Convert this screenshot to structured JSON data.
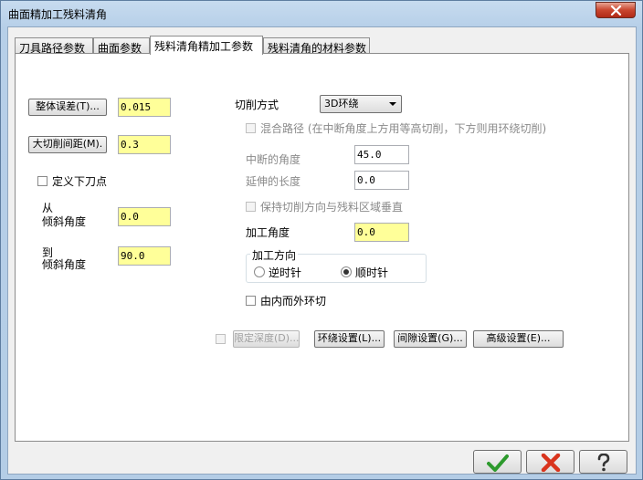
{
  "window": {
    "title": "曲面精加工残料清角"
  },
  "tabs": [
    {
      "label": "刀具路径参数"
    },
    {
      "label": "曲面参数"
    },
    {
      "label": "残料清角精加工参数"
    },
    {
      "label": "残料清角的材料参数"
    }
  ],
  "left": {
    "tolerance_button": "整体误差(T)...",
    "tolerance_value": "0.015",
    "stepover_button": "大切削间距(M).",
    "stepover_value": "0.3",
    "entry_point_label": "定义下刀点",
    "from_label_1": "从",
    "from_label_2": "倾斜角度",
    "from_value": "0.0",
    "to_label_1": "到",
    "to_label_2": "倾斜角度",
    "to_value": "90.0"
  },
  "right": {
    "cut_method_label": "切削方式",
    "cut_method_value": "3D环绕",
    "hybrid_label": "混合路径 (在中断角度上方用等高切削，下方则用环绕切削)",
    "break_angle_label": "中断的角度",
    "break_angle_value": "45.0",
    "extend_length_label": "延伸的长度",
    "extend_length_value": "0.0",
    "keep_perp_label": "保持切削方向与残料区域垂直",
    "machining_angle_label": "加工角度",
    "machining_angle_value": "0.0",
    "direction_group_label": "加工方向",
    "ccw_label": "逆时针",
    "cw_label": "顺时针",
    "inside_out_label": "由内而外环切"
  },
  "bottom_buttons": {
    "depth_label": "限定深度(D)...",
    "loop_label": "环绕设置(L)...",
    "gap_label": "间隙设置(G)...",
    "advanced_label": "高级设置(E)..."
  },
  "footer": {
    "ok_icon": "checkmark-icon",
    "cancel_icon": "x-icon",
    "help_icon": "question-icon",
    "ok_color": "#2d9a2d",
    "cancel_color": "#d9341d"
  }
}
